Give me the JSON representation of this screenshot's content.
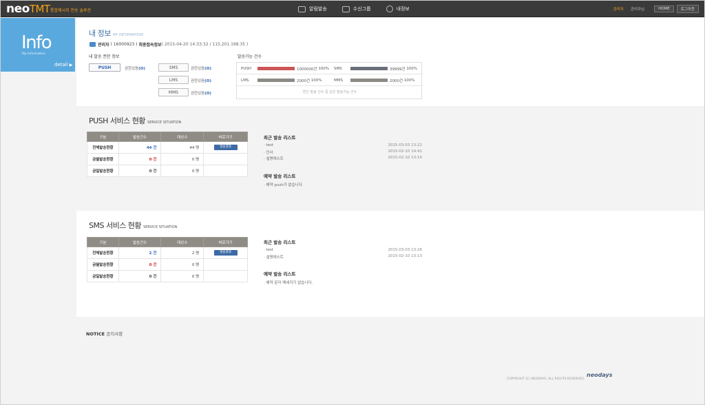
{
  "header": {
    "logo_main": "neo",
    "logo_accent": "TMT",
    "logo_sub": "통합메시지 전송 솔루션",
    "nav": [
      {
        "label": "알림발송",
        "icon": "send-icon"
      },
      {
        "label": "수신그룹",
        "icon": "group-icon"
      },
      {
        "label": "내정보",
        "icon": "user-icon"
      }
    ],
    "util_admin": "관리자",
    "util_info": "관리자님",
    "util_home": "HOME",
    "util_logout": "로그아웃"
  },
  "side": {
    "title": "Info",
    "subtitle": "My Information",
    "detail": "detail",
    "arrow": "▶"
  },
  "my_info": {
    "title": "내 정보",
    "title_en": "MY INFORMATION",
    "admin_label": "관리자",
    "admin_id": "( 16000923 )",
    "last_login_label": "최종접속정보",
    "last_login_value": "( 2015-04-20 14:33:32 / 115.201.198.35 )",
    "perm_title": "내 발송 권한 정보",
    "perms": [
      {
        "name": "PUSH",
        "label": "권한있음",
        "value": "(O)"
      },
      {
        "name": "SMS",
        "label": "권한있음",
        "value": "(O)"
      },
      {
        "name": "LMS",
        "label": "권한있음",
        "value": "(O)"
      },
      {
        "name": "MMS",
        "label": "권한있음",
        "value": "(O)"
      }
    ],
    "quota_title": "발송가능 건수",
    "quota": [
      {
        "name": "PUSH",
        "count": "1000000건",
        "percent": "100%",
        "color": "#cc5555",
        "fill": 1.0
      },
      {
        "name": "SMS",
        "count": "39999건",
        "percent": "100%",
        "color": "#6a6f7a",
        "fill": 1.0
      },
      {
        "name": "LMS",
        "count": "2000건",
        "percent": "100%",
        "color": "#8d8a85",
        "fill": 1.0
      },
      {
        "name": "MMS",
        "count": "2000건",
        "percent": "100%",
        "color": "#8d8a85",
        "fill": 1.0
      }
    ],
    "quota_note": "연간 발송 건수 중 남은 발송가능 건수"
  },
  "push_service": {
    "title": "PUSH 서비스 현황",
    "title_en": "SERVICE SITUATION",
    "headers": [
      "구분",
      "발송건수",
      "대상수",
      "바로가기"
    ],
    "rows": [
      {
        "label": "전체발송현황",
        "sent": "44 건",
        "target": "44 명",
        "button": "발송결과"
      },
      {
        "label": "금월발송현황",
        "sent": "0 건",
        "target": "0 명",
        "button": ""
      },
      {
        "label": "금일발송현황",
        "sent": "0 건",
        "target": "0 명",
        "button": ""
      }
    ],
    "recent_title": "최근 발송 리스트",
    "recent": [
      {
        "name": "test",
        "date": "2015-03-03 13:22"
      },
      {
        "name": "인사",
        "date": "2015-02-10 14:41"
      },
      {
        "name": "설명테스트",
        "date": "2015-02-10 13:14"
      }
    ],
    "reserved_title": "예약 발송 리스트",
    "reserved_empty": "예약 push가 없습니다."
  },
  "sms_service": {
    "title": "SMS 서비스 현황",
    "title_en": "SERVICE SITUATION",
    "headers": [
      "구분",
      "발송건수",
      "대상수",
      "바로가기"
    ],
    "rows": [
      {
        "label": "전체발송현황",
        "sent": "2 건",
        "target": "2 명",
        "button": "발송결과"
      },
      {
        "label": "금월발송현황",
        "sent": "0 건",
        "target": "0 명",
        "button": ""
      },
      {
        "label": "금일발송현황",
        "sent": "0 건",
        "target": "0 명",
        "button": ""
      }
    ],
    "recent_title": "최근 발송 리스트",
    "recent": [
      {
        "name": "test",
        "date": "2015-03-03 13:26"
      },
      {
        "name": "설명테스트",
        "date": "2015-02-10 13:13"
      }
    ],
    "reserved_title": "예약 발송 리스트",
    "reserved_empty": "예약 문자 메세지가 없습니다."
  },
  "notice": {
    "title": "NOTICE",
    "title_ko": "공지사항"
  },
  "footer": {
    "copyright": "COPYRIGHT (C) NEODAYS. ALL RIGHTS RESERVED.",
    "brand": "neodays"
  }
}
